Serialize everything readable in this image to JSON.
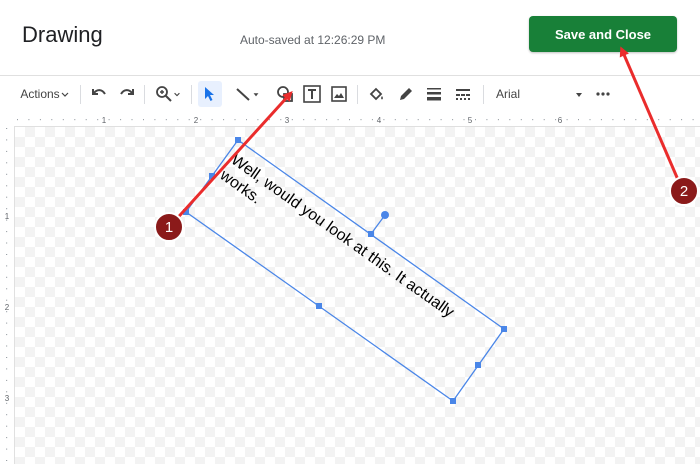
{
  "header": {
    "title": "Drawing",
    "autosave": "Auto-saved at 12:26:29 PM",
    "save_close_label": "Save and Close"
  },
  "toolbar": {
    "actions_label": "Actions",
    "font_label": "Arial",
    "icons": [
      "undo-icon",
      "redo-icon",
      "zoom-icon",
      "select-icon",
      "line-icon",
      "shape-icon",
      "textbox-icon",
      "image-icon",
      "fill-color-icon",
      "pen-icon",
      "line-weight-icon",
      "line-dash-icon",
      "more-icon"
    ]
  },
  "ruler": {
    "top_labels": [
      "1",
      "2",
      "3",
      "4",
      "5",
      "6"
    ],
    "left_labels": [
      "1",
      "2",
      "3"
    ]
  },
  "canvas": {
    "textbox_line1": "Well, would you look at this. It actually",
    "textbox_line2": "works."
  },
  "annotations": {
    "badge1": "1",
    "badge2": "2"
  },
  "colors": {
    "save_button": "#188038",
    "selection": "#4a86e8",
    "annotation_arrow": "#ea2c2c",
    "badge": "#8b1a1a"
  }
}
